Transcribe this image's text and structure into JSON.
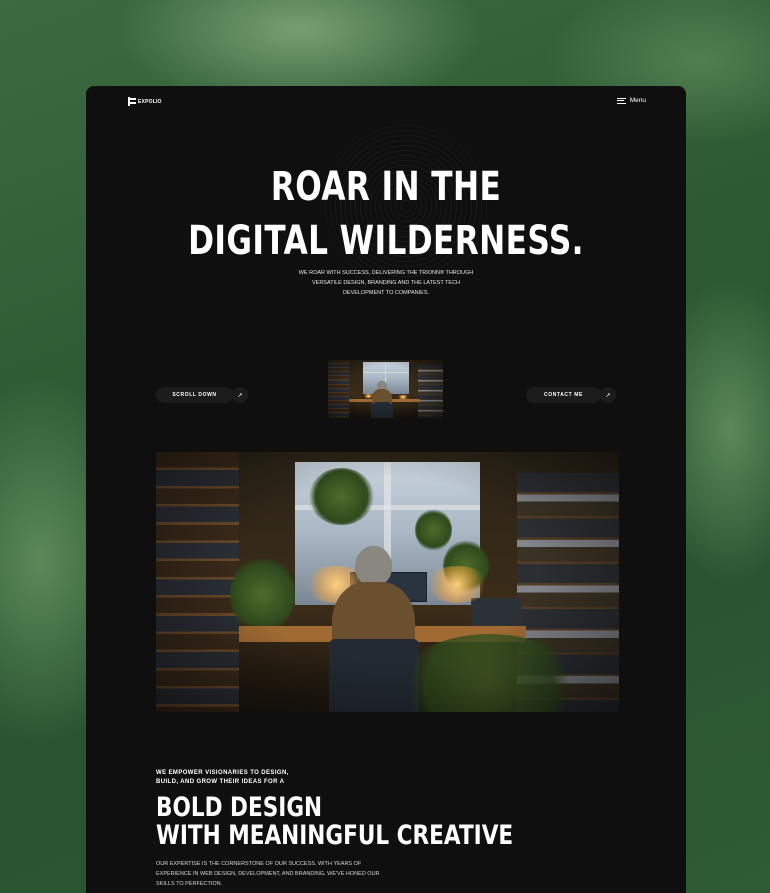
{
  "brand": {
    "name": "EXPOLIO"
  },
  "nav": {
    "menu_label": "Menu"
  },
  "hero": {
    "title_line1": "ROAR IN THE",
    "title_line2": "DIGITAL WILDERNESS.",
    "subtitle": "WE ROAR WITH SUCCESS, DELIVERING THE TRIONN® THROUGH VERSATILE DESIGN, BRANDING AND THE LATEST TECH DEVELOPMENT TO COMPANIES.",
    "scroll_label": "SCROLL DOWN",
    "contact_label": "CONTACT ME",
    "arrow_glyph": "↗"
  },
  "about": {
    "kicker": "WE EMPOWER VISIONARIES TO DESIGN, BUILD, AND GROW THEIR IDEAS FOR A",
    "title_line1": "BOLD DESIGN",
    "title_line2": "WITH MEANINGFUL CREATIVE",
    "body": "OUR EXPERTISE IS THE CORNERSTONE OF OUR SUCCESS. WITH YEARS OF EXPERIENCE IN WEB DESIGN, DEVELOPMENT, AND BRANDING, WE'VE HONED OUR SKILLS TO PERFECTION."
  },
  "colors": {
    "page_bg": "#0f0f0f",
    "backdrop": "#2f5a35",
    "pill_bg": "#1c1c1c",
    "text": "#ffffff"
  },
  "icons": [
    "logo-mark-icon",
    "hamburger-icon",
    "arrow-up-right-icon"
  ]
}
